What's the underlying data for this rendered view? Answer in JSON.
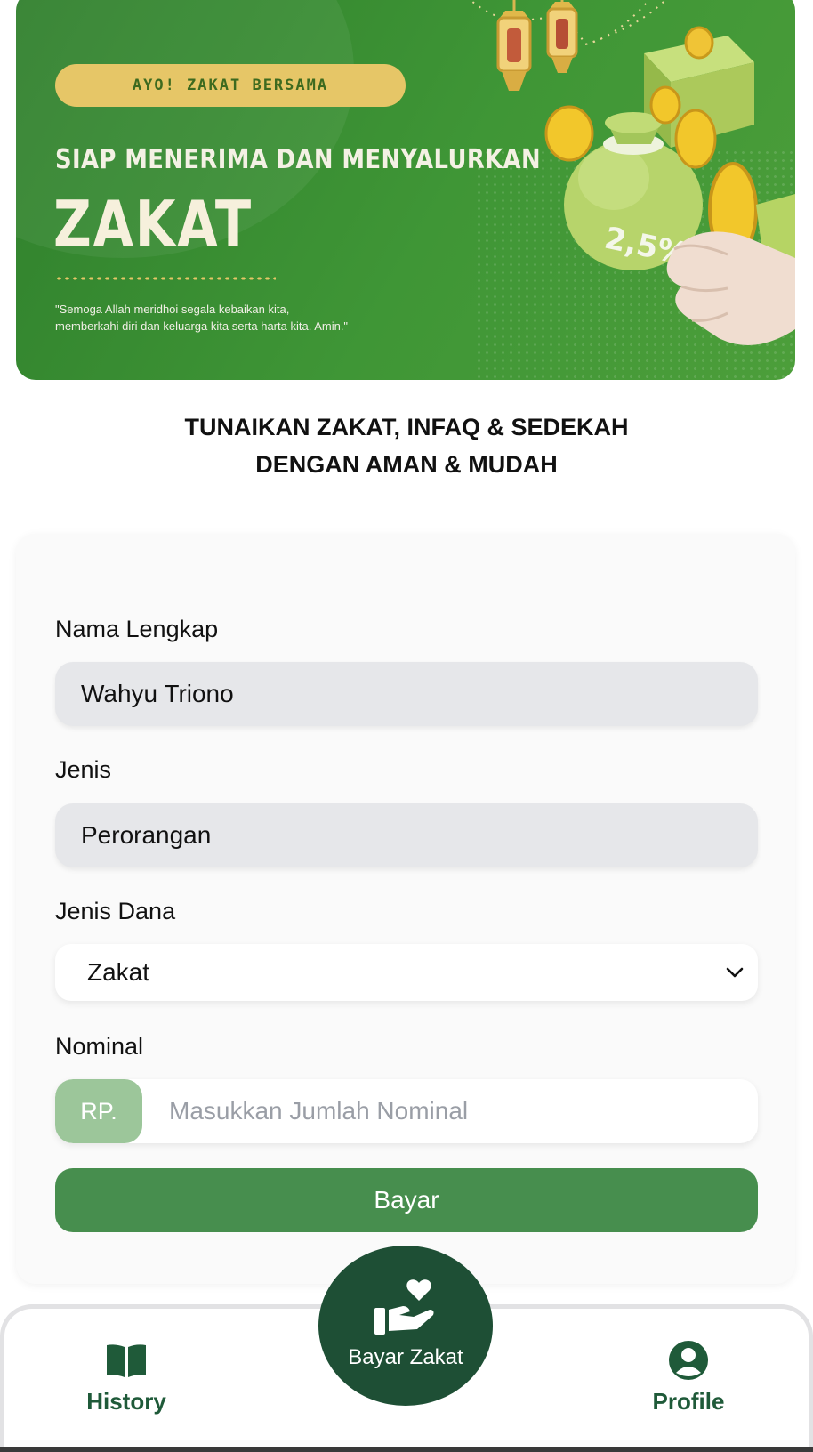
{
  "banner": {
    "pill_text": "AYO! ZAKAT BERSAMA",
    "subtitle": "SIAP MENERIMA DAN MENYALURKAN",
    "title": "ZAKAT",
    "quote_line1": "\"Semoga Allah meridhoi segala kebaikan kita,",
    "quote_line2": "memberkahi diri dan keluarga kita serta harta kita. Amin.\"",
    "badge_text": "2,5%"
  },
  "headline": {
    "line1": "TUNAIKAN ZAKAT, INFAQ & SEDEKAH",
    "line2": "DENGAN AMAN & MUDAH"
  },
  "form": {
    "name_label": "Nama Lengkap",
    "name_value": "Wahyu Triono",
    "type_label": "Jenis",
    "type_value": "Perorangan",
    "fund_label": "Jenis Dana",
    "fund_selected": "Zakat",
    "nominal_label": "Nominal",
    "currency_prefix": "RP.",
    "nominal_placeholder": "Masukkan Jumlah Nominal",
    "submit_label": "Bayar"
  },
  "nav": {
    "history_label": "History",
    "center_label": "Bayar Zakat",
    "profile_label": "Profile"
  },
  "colors": {
    "brand_dark": "#1e4f35",
    "button_green": "#478e4e",
    "rp_bg": "#9cc69a",
    "banner_green": "#3f9636",
    "gold": "#e6c667"
  },
  "icons": {
    "history": "book-icon",
    "center": "hand-heart-icon",
    "profile": "user-circle-icon",
    "select": "chevron-down-icon"
  }
}
